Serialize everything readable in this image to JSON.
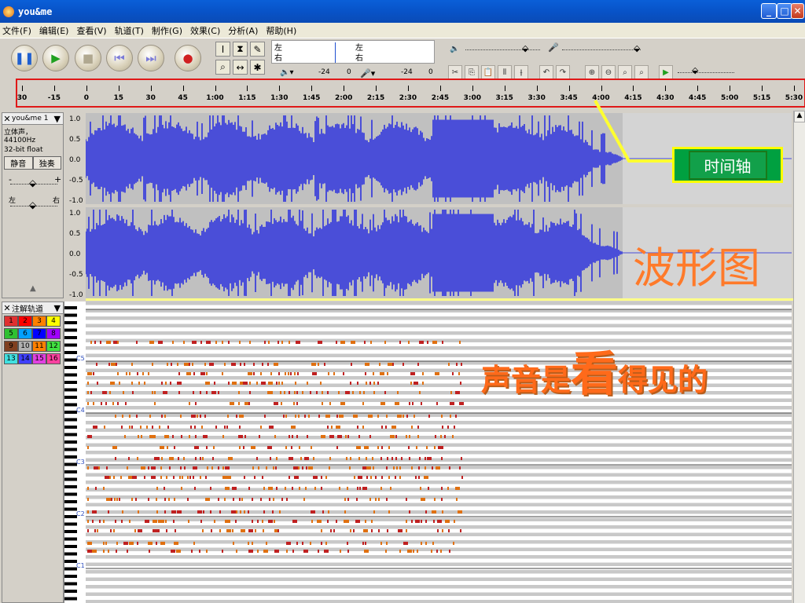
{
  "window": {
    "title": "you&me"
  },
  "menu": [
    "文件(F)",
    "编辑(E)",
    "查看(V)",
    "轨道(T)",
    "制作(G)",
    "效果(C)",
    "分析(A)",
    "帮助(H)"
  ],
  "toolbar": {
    "transport": [
      "pause-icon",
      "play-icon",
      "stop-icon",
      "skip-start-icon",
      "skip-end-icon",
      "record-icon"
    ],
    "meter": {
      "left_label": "左",
      "right_label": "右",
      "db_values": [
        "-24",
        "0",
        "-24",
        "0"
      ]
    },
    "colors": {
      "play": "#20a020",
      "record": "#d02020",
      "pause": "#2060d0"
    }
  },
  "ruler": {
    "labels": [
      "30",
      "-15",
      "0",
      "15",
      "30",
      "45",
      "1:00",
      "1:15",
      "1:30",
      "1:45",
      "2:00",
      "2:15",
      "2:30",
      "2:45",
      "3:00",
      "3:15",
      "3:30",
      "3:45",
      "4:00",
      "4:15",
      "4:30",
      "4:45",
      "5:00",
      "5:15",
      "5:30"
    ]
  },
  "audio_track": {
    "name": "you&me 1",
    "info1": "立体声，44100Hz",
    "info2": "32-bit float",
    "mute_label": "静音",
    "solo_label": "独奏",
    "gain_minus": "-",
    "gain_plus": "+",
    "pan_left": "左",
    "pan_right": "右",
    "yaxis": [
      "1.0",
      "0.5",
      "0.0",
      "-0.5",
      "-1.0"
    ],
    "wave_color": "#4a4ed8",
    "bg_color": "#c0c0c0"
  },
  "note_track": {
    "name": "注解轨道",
    "channels": [
      "1",
      "2",
      "3",
      "4",
      "5",
      "6",
      "7",
      "8",
      "9",
      "10",
      "11",
      "12",
      "13",
      "14",
      "15",
      "16"
    ],
    "octaves": [
      "C5",
      "C4",
      "C3",
      "C2",
      "C1"
    ],
    "channel_colors": [
      "#e03030",
      "#ff0000",
      "#ff8000",
      "#ffff00",
      "#30c030",
      "#00a0ff",
      "#0000ff",
      "#a000ff",
      "#804020",
      "#b0b0b0",
      "#ff8000",
      "#40e040",
      "#40e0e0",
      "#4040ff",
      "#e040e0",
      "#ff40a0"
    ]
  },
  "annotations": {
    "timeline": "时间轴",
    "waveform": "波形图",
    "sound_pre": "声音是",
    "sound_big": "看",
    "sound_post": "得见的"
  }
}
